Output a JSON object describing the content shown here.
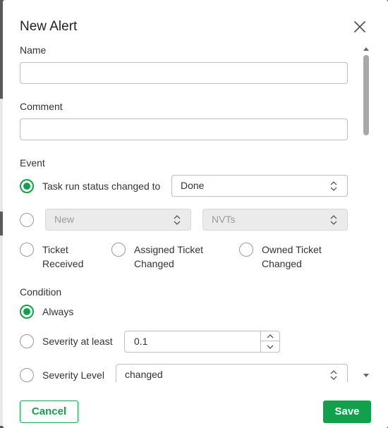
{
  "dialog": {
    "title": "New Alert",
    "cancel_label": "Cancel",
    "save_label": "Save"
  },
  "form": {
    "name_label": "Name",
    "name_value": "",
    "comment_label": "Comment",
    "comment_value": "",
    "event_label": "Event",
    "event_task_run_label": "Task run status changed to",
    "event_task_run_status": "Done",
    "event_secinfo_type": "New",
    "event_secinfo_category": "NVTs",
    "event_ticket_received_line1": "Ticket",
    "event_ticket_received_line2": "Received",
    "event_assigned_ticket_line1": "Assigned Ticket",
    "event_assigned_ticket_line2": "Changed",
    "event_owned_ticket_line1": "Owned Ticket",
    "event_owned_ticket_line2": "Changed",
    "condition_label": "Condition",
    "condition_always_label": "Always",
    "condition_severity_at_least_label": "Severity at least",
    "condition_severity_at_least_value": "0.1",
    "condition_severity_level_label": "Severity Level",
    "condition_severity_level_value": "changed"
  },
  "colors": {
    "accent": "#11a14a"
  }
}
